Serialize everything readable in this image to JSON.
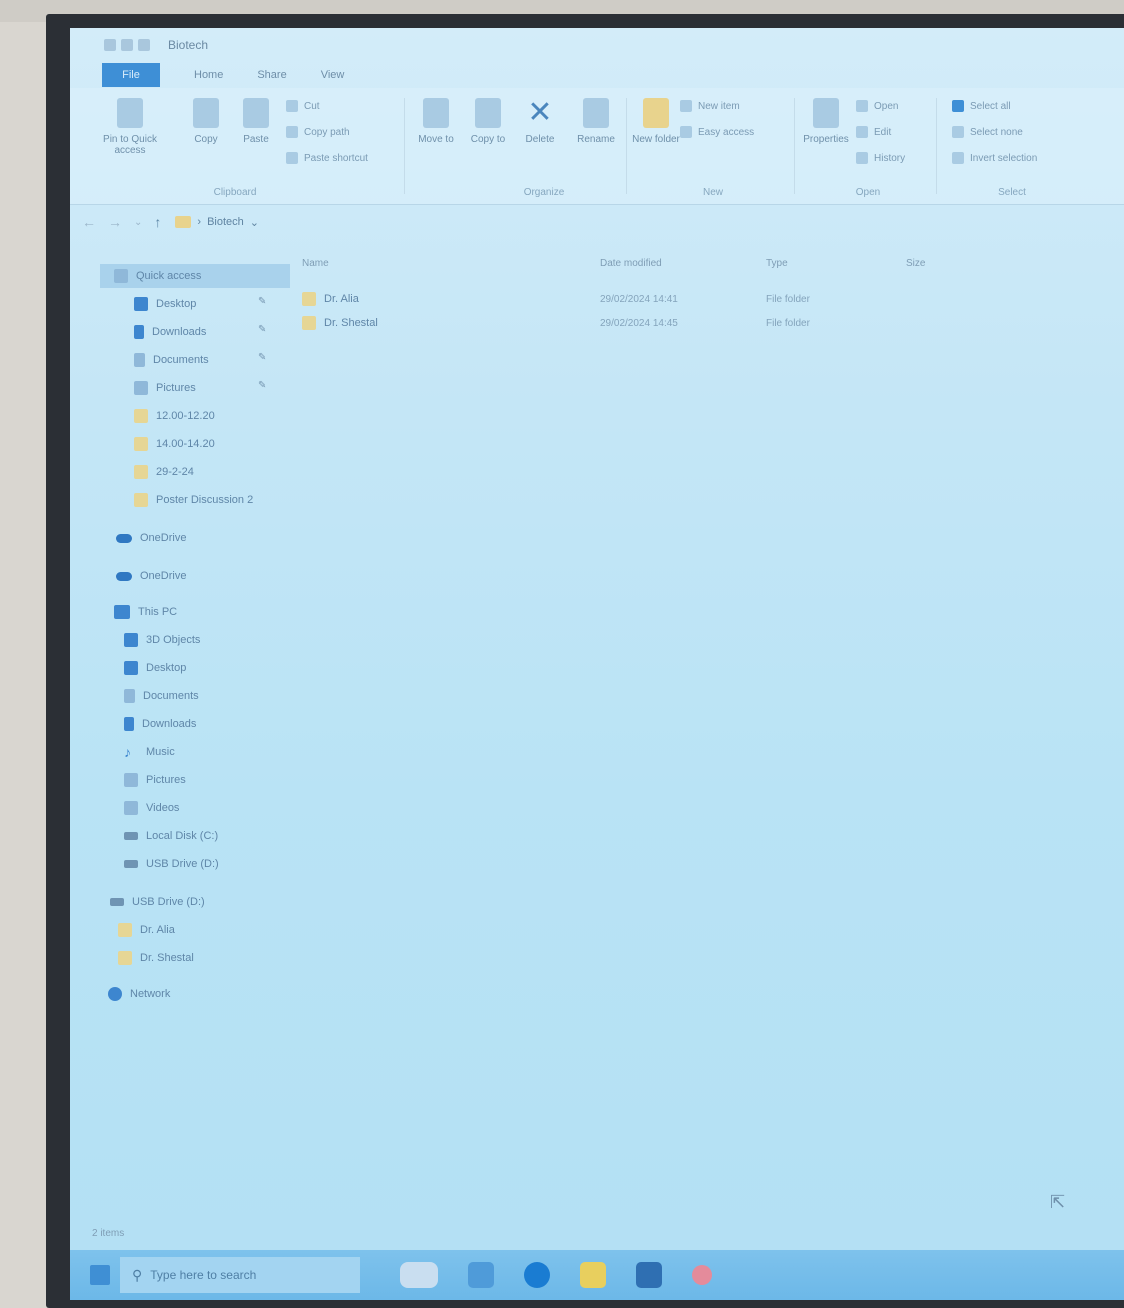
{
  "window": {
    "title": "Biotech",
    "menu_tabs": [
      "File",
      "Home",
      "Share",
      "View"
    ]
  },
  "ribbon": {
    "clipboard": {
      "label": "Clipboard",
      "pin": "Pin to Quick access",
      "copy": "Copy",
      "paste": "Paste",
      "cut": "Cut",
      "copy_path": "Copy path",
      "paste_shortcut": "Paste shortcut"
    },
    "organize": {
      "label": "Organize",
      "move_to": "Move to",
      "copy_to": "Copy to",
      "delete": "Delete",
      "rename": "Rename"
    },
    "new": {
      "label": "New",
      "new_folder": "New folder",
      "new_item": "New item",
      "easy_access": "Easy access"
    },
    "open": {
      "label": "Open",
      "properties": "Properties",
      "open": "Open",
      "edit": "Edit",
      "history": "History"
    },
    "select": {
      "label": "Select",
      "select_all": "Select all",
      "select_none": "Select none",
      "invert": "Invert selection"
    }
  },
  "address": {
    "path": "Biotech"
  },
  "sidebar": [
    {
      "label": "Quick access",
      "icon": "star-icon",
      "selected": true
    },
    {
      "label": "Desktop",
      "icon": "desktop-icon",
      "pinned": true
    },
    {
      "label": "Downloads",
      "icon": "download-icon",
      "pinned": true
    },
    {
      "label": "Documents",
      "icon": "documents-icon",
      "pinned": true
    },
    {
      "label": "Pictures",
      "icon": "pictures-icon",
      "pinned": true
    },
    {
      "label": "12.00-12.20",
      "icon": "folder-icon"
    },
    {
      "label": "14.00-14.20",
      "icon": "folder-icon"
    },
    {
      "label": "29-2-24",
      "icon": "folder-icon"
    },
    {
      "label": "Poster Discussion 2",
      "icon": "folder-icon"
    },
    {
      "label": "OneDrive",
      "icon": "cloud-icon"
    },
    {
      "label": "OneDrive",
      "icon": "cloud-icon"
    },
    {
      "label": "This PC",
      "icon": "pc-icon"
    },
    {
      "label": "3D Objects",
      "icon": "cube-icon"
    },
    {
      "label": "Desktop",
      "icon": "desktop-icon"
    },
    {
      "label": "Documents",
      "icon": "documents-icon"
    },
    {
      "label": "Downloads",
      "icon": "download-icon"
    },
    {
      "label": "Music",
      "icon": "music-icon"
    },
    {
      "label": "Pictures",
      "icon": "pictures-icon"
    },
    {
      "label": "Videos",
      "icon": "videos-icon"
    },
    {
      "label": "Local Disk (C:)",
      "icon": "disk-icon"
    },
    {
      "label": "USB Drive (D:)",
      "icon": "usb-icon"
    },
    {
      "label": "USB Drive (D:)",
      "icon": "usb-icon"
    },
    {
      "label": "Dr. Alia",
      "icon": "folder-icon"
    },
    {
      "label": "Dr. Shestal",
      "icon": "folder-icon"
    },
    {
      "label": "Network",
      "icon": "network-icon"
    }
  ],
  "columns": {
    "name": "Name",
    "date": "Date modified",
    "type": "Type",
    "size": "Size"
  },
  "files": [
    {
      "name": "Dr. Alia",
      "date": "29/02/2024 14:41",
      "type": "File folder"
    },
    {
      "name": "Dr. Shestal",
      "date": "29/02/2024 14:45",
      "type": "File folder"
    }
  ],
  "status": {
    "items": "2 items"
  },
  "taskbar": {
    "search_placeholder": "Type here to search"
  },
  "colors": {
    "accent": "#3e8fd6",
    "taskbar": "#7ec2ec",
    "folder": "#e6d695"
  }
}
